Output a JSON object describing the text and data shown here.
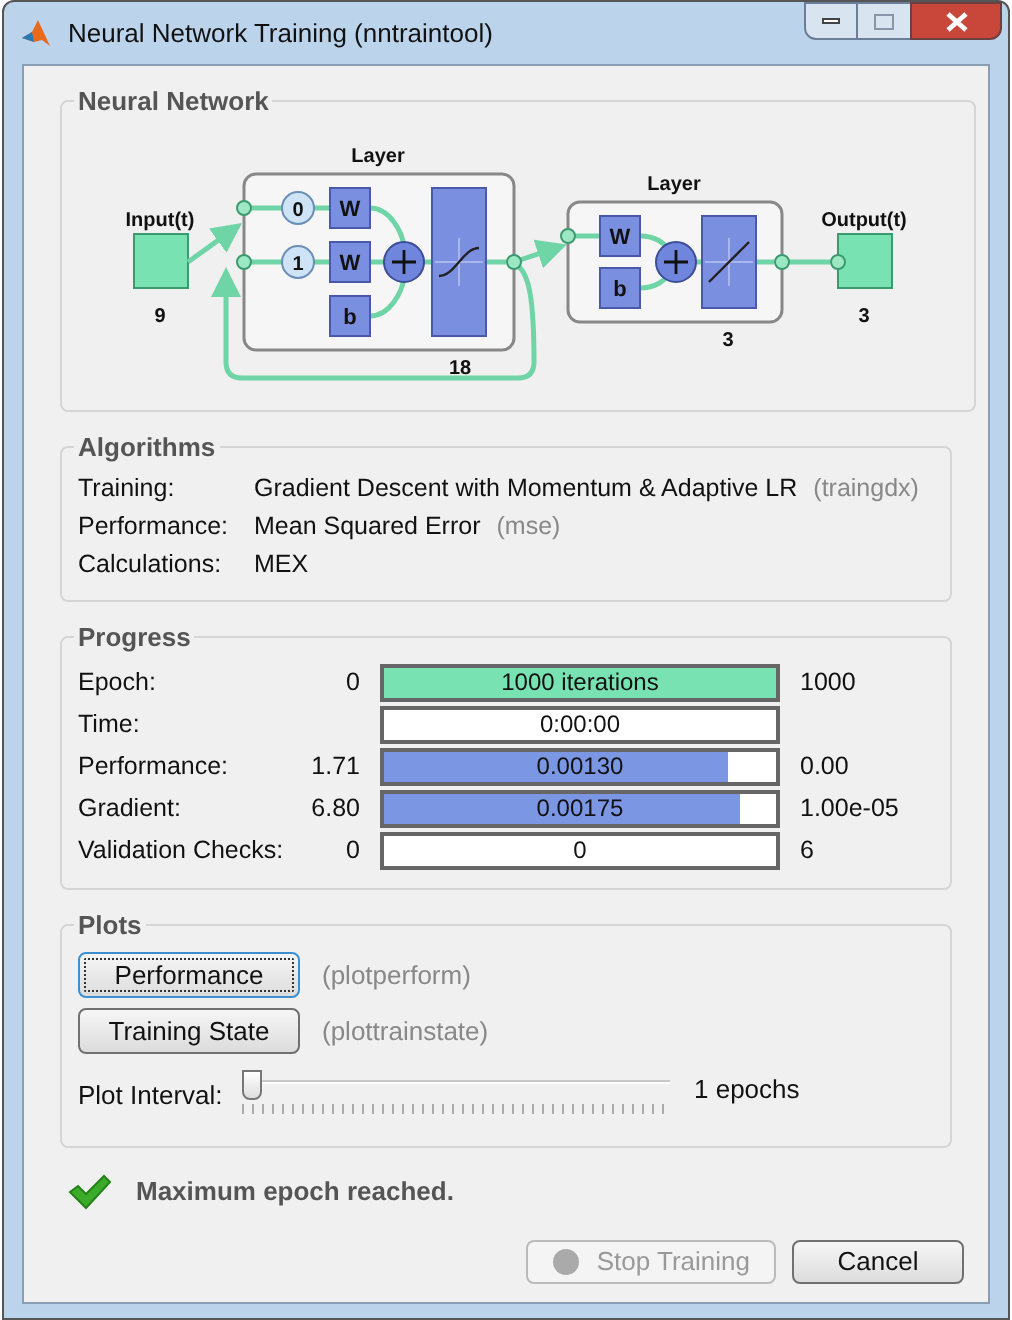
{
  "window": {
    "title": "Neural Network Training (nntraintool)"
  },
  "network": {
    "title": "Neural Network",
    "input": {
      "label": "Input(t)",
      "size": "9"
    },
    "layers": [
      {
        "title": "Layer",
        "size": "18",
        "kind": "sigmoid",
        "delays": [
          "0",
          "1"
        ],
        "weights": [
          "W",
          "W"
        ],
        "bias": "b",
        "feedback": true
      },
      {
        "title": "Layer",
        "size": "3",
        "kind": "linear",
        "weights": [
          "W"
        ],
        "bias": "b"
      }
    ],
    "output": {
      "label": "Output(t)",
      "size": "3"
    }
  },
  "algorithms": {
    "title": "Algorithms",
    "rows": [
      {
        "label": "Training:",
        "value": "Gradient Descent with Momentum & Adaptive LR",
        "code": "(traingdx)"
      },
      {
        "label": "Performance:",
        "value": "Mean Squared Error",
        "code": "(mse)"
      },
      {
        "label": "Calculations:",
        "value": "MEX"
      }
    ]
  },
  "progress": {
    "title": "Progress",
    "rows": [
      {
        "label": "Epoch:",
        "start": "0",
        "bar_text": "1000 iterations",
        "level": 1,
        "color": "#78e2b2",
        "end": "1000"
      },
      {
        "label": "Time:",
        "bar_text": "0:00:00",
        "level": 0
      },
      {
        "label": "Performance:",
        "start": "1.71",
        "bar_text": "0.00130",
        "level": 0.88,
        "color": "#7b97e3",
        "end": "0.00"
      },
      {
        "label": "Gradient:",
        "start": "6.80",
        "bar_text": "0.00175",
        "level": 0.91,
        "color": "#7b97e3",
        "end": "1.00e-05"
      },
      {
        "label": "Validation Checks:",
        "start": "0",
        "bar_text": "0",
        "level": 0,
        "end": "6"
      }
    ]
  },
  "plots": {
    "title": "Plots",
    "buttons": [
      {
        "label": "Performance",
        "function": "(plotperform)",
        "focused": true
      },
      {
        "label": "Training State",
        "function": "(plottrainstate)",
        "focused": false
      }
    ],
    "interval": {
      "label": "Plot Interval:",
      "level": 0,
      "reading": "1 epochs"
    }
  },
  "status": {
    "message": "Maximum epoch reached.",
    "ok": true
  },
  "buttons": [
    {
      "label": "Stop Training",
      "kind": "stop",
      "disabled": true
    },
    {
      "label": "Cancel",
      "kind": "plain",
      "disabled": false
    }
  ]
}
